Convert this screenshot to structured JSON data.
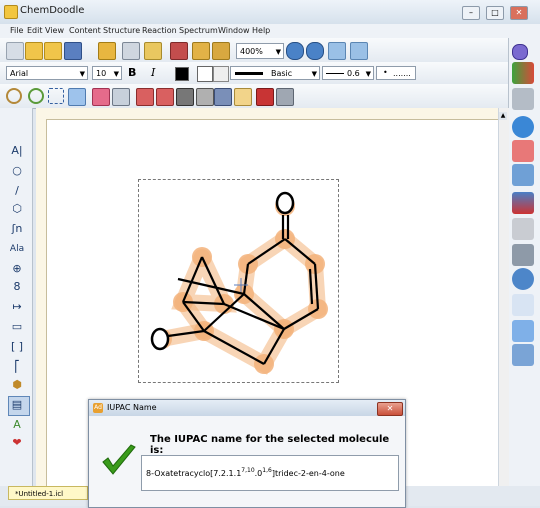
{
  "window": {
    "title": "ChemDoodle",
    "minimize": "–",
    "maximize": "□",
    "close": "✕"
  },
  "menu": [
    "File",
    "Edit",
    "View",
    "Content",
    "Structure",
    "Reaction",
    "Spectrum",
    "Window",
    "Help"
  ],
  "toolbar": {
    "zoom": "400%",
    "font_family": "Arial",
    "font_size": "10",
    "bold": "B",
    "italic": "I",
    "line_style": "Basic",
    "line_width": "0.6",
    "zoom_arrow": "▼"
  },
  "palette_left": [
    "A|",
    "○",
    "/",
    "⬡",
    "ʃn",
    "Ala",
    "⊕",
    "8",
    "↦",
    "▭",
    "[ ]",
    "⎡",
    "⬢",
    "▤",
    "A",
    "❤"
  ],
  "document": {
    "tab_name": "*Untitled-1.icl"
  },
  "dialog": {
    "title": "IUPAC Name",
    "icon": "Ad",
    "close": "✕",
    "heading": "The IUPAC name for the selected molecule is:",
    "name_part1": "8-Oxatetracyclo[7.2.1.1",
    "sup1": "7,10",
    "name_part2": ".0",
    "sup2": "1,6",
    "name_part3": "]tridec-2-en-4-one"
  },
  "colors": {
    "accent": "#f2a766",
    "ruler": "#fbf6e6",
    "check": "#3a9b1b"
  }
}
